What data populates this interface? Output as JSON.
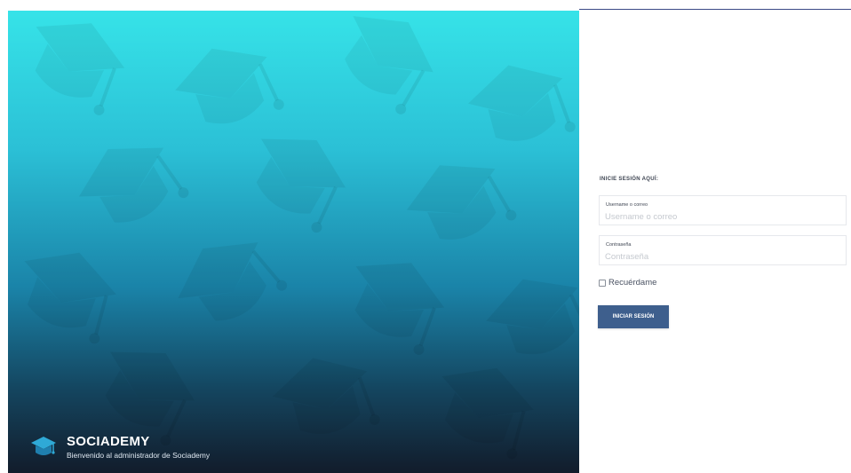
{
  "brand": {
    "name": "SOCIADEMY",
    "tagline": "Bienvenido al administrador de Sociademy"
  },
  "login": {
    "title": "INICIE SESIÓN AQUÍ:",
    "username": {
      "label": "Username o correo",
      "placeholder": "Username o correo",
      "value": ""
    },
    "password": {
      "label": "Contraseña",
      "placeholder": "Contraseña",
      "value": ""
    },
    "remember_label": "Recuérdame",
    "remember_checked": false,
    "submit_label": "INICIAR SESIÓN"
  },
  "colors": {
    "gradient_top": "#36e3e8",
    "gradient_bottom": "#121c2b",
    "button": "#3e5f8d",
    "top_rule": "#3b4a86"
  }
}
